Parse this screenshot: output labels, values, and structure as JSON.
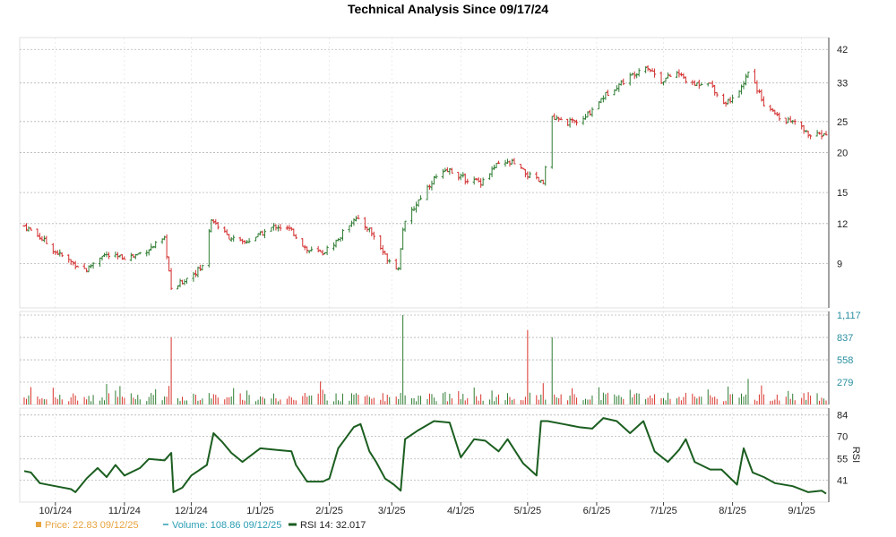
{
  "chart_data": {
    "type": "ohlc",
    "title": "Technical Analysis Since 09/17/24",
    "price_axis": {
      "scale": "log",
      "ticks": [
        9,
        12,
        15,
        20,
        25,
        33,
        42
      ],
      "range": [
        6.8,
        44
      ]
    },
    "volume_axis": {
      "ticks": [
        "279",
        "558",
        "837",
        "1,117"
      ],
      "tick_values": [
        279,
        558,
        837,
        1117
      ],
      "range": [
        0,
        1117
      ]
    },
    "rsi_axis": {
      "label": "RSI",
      "ticks": [
        41,
        55,
        70,
        84
      ],
      "range": [
        30,
        85
      ]
    },
    "date_axis": {
      "start": "2024-09-17",
      "end": "2025-09-12",
      "ticks": [
        "10/1/24",
        "11/1/24",
        "12/1/24",
        "1/1/25",
        "2/1/25",
        "3/1/25",
        "4/1/25",
        "5/1/25",
        "6/1/25",
        "7/1/25",
        "8/1/25",
        "9/1/25"
      ]
    },
    "grid": true,
    "price_series": [
      {
        "date": "2024-09-17",
        "close": 11.8
      },
      {
        "date": "2024-09-24",
        "close": 10.9
      },
      {
        "date": "2024-10-01",
        "close": 9.8
      },
      {
        "date": "2024-10-08",
        "close": 9.1
      },
      {
        "date": "2024-10-15",
        "close": 8.6
      },
      {
        "date": "2024-10-22",
        "close": 9.6
      },
      {
        "date": "2024-10-29",
        "close": 9.4
      },
      {
        "date": "2024-11-05",
        "close": 9.5
      },
      {
        "date": "2024-11-12",
        "close": 10.0
      },
      {
        "date": "2024-11-19",
        "close": 10.7
      },
      {
        "date": "2024-11-22",
        "close": 7.4
      },
      {
        "date": "2024-11-29",
        "close": 8.1
      },
      {
        "date": "2024-12-06",
        "close": 8.8
      },
      {
        "date": "2024-12-10",
        "close": 12.4
      },
      {
        "date": "2024-12-17",
        "close": 11.0
      },
      {
        "date": "2024-12-24",
        "close": 10.4
      },
      {
        "date": "2025-01-01",
        "close": 11.1
      },
      {
        "date": "2025-01-08",
        "close": 11.8
      },
      {
        "date": "2025-01-15",
        "close": 11.4
      },
      {
        "date": "2025-01-22",
        "close": 9.9
      },
      {
        "date": "2025-01-29",
        "close": 9.7
      },
      {
        "date": "2025-02-05",
        "close": 10.7
      },
      {
        "date": "2025-02-12",
        "close": 12.5
      },
      {
        "date": "2025-02-19",
        "close": 11.5
      },
      {
        "date": "2025-02-26",
        "close": 9.5
      },
      {
        "date": "2025-03-04",
        "close": 8.7
      },
      {
        "date": "2025-03-06",
        "close": 11.6
      },
      {
        "date": "2025-03-13",
        "close": 14.2
      },
      {
        "date": "2025-03-20",
        "close": 16.6
      },
      {
        "date": "2025-03-27",
        "close": 17.6
      },
      {
        "date": "2025-04-03",
        "close": 16.5
      },
      {
        "date": "2025-04-10",
        "close": 16.2
      },
      {
        "date": "2025-04-17",
        "close": 18.2
      },
      {
        "date": "2025-04-24",
        "close": 18.6
      },
      {
        "date": "2025-05-01",
        "close": 17.0
      },
      {
        "date": "2025-05-08",
        "close": 16.0
      },
      {
        "date": "2025-05-12",
        "close": 25.5
      },
      {
        "date": "2025-05-19",
        "close": 24.8
      },
      {
        "date": "2025-05-26",
        "close": 25.2
      },
      {
        "date": "2025-06-02",
        "close": 29.0
      },
      {
        "date": "2025-06-09",
        "close": 32.0
      },
      {
        "date": "2025-06-16",
        "close": 34.5
      },
      {
        "date": "2025-06-23",
        "close": 37.5
      },
      {
        "date": "2025-06-30",
        "close": 33.5
      },
      {
        "date": "2025-07-07",
        "close": 35.5
      },
      {
        "date": "2025-07-14",
        "close": 32.5
      },
      {
        "date": "2025-07-21",
        "close": 33.5
      },
      {
        "date": "2025-07-28",
        "close": 28.5
      },
      {
        "date": "2025-08-04",
        "close": 30.5
      },
      {
        "date": "2025-08-08",
        "close": 36.0
      },
      {
        "date": "2025-08-15",
        "close": 28.5
      },
      {
        "date": "2025-08-22",
        "close": 25.5
      },
      {
        "date": "2025-08-29",
        "close": 24.8
      },
      {
        "date": "2025-09-05",
        "close": 22.5
      },
      {
        "date": "2025-09-12",
        "close": 22.83
      }
    ],
    "rsi_series": [
      {
        "date": "2024-09-17",
        "value": 47
      },
      {
        "date": "2024-09-20",
        "value": 46
      },
      {
        "date": "2024-09-24",
        "value": 39
      },
      {
        "date": "2024-10-01",
        "value": 37
      },
      {
        "date": "2024-10-08",
        "value": 35
      },
      {
        "date": "2024-10-10",
        "value": 33
      },
      {
        "date": "2024-10-15",
        "value": 42
      },
      {
        "date": "2024-10-20",
        "value": 49
      },
      {
        "date": "2024-10-24",
        "value": 43
      },
      {
        "date": "2024-10-28",
        "value": 51
      },
      {
        "date": "2024-11-01",
        "value": 44
      },
      {
        "date": "2024-11-08",
        "value": 49
      },
      {
        "date": "2024-11-12",
        "value": 55
      },
      {
        "date": "2024-11-19",
        "value": 54
      },
      {
        "date": "2024-11-22",
        "value": 59
      },
      {
        "date": "2024-11-23",
        "value": 33
      },
      {
        "date": "2024-11-27",
        "value": 36
      },
      {
        "date": "2024-12-01",
        "value": 44
      },
      {
        "date": "2024-12-08",
        "value": 51
      },
      {
        "date": "2024-12-11",
        "value": 72
      },
      {
        "date": "2024-12-15",
        "value": 66
      },
      {
        "date": "2024-12-19",
        "value": 59
      },
      {
        "date": "2024-12-24",
        "value": 53
      },
      {
        "date": "2025-01-01",
        "value": 62
      },
      {
        "date": "2025-01-08",
        "value": 61
      },
      {
        "date": "2025-01-15",
        "value": 60
      },
      {
        "date": "2025-01-17",
        "value": 51
      },
      {
        "date": "2025-01-22",
        "value": 40
      },
      {
        "date": "2025-01-29",
        "value": 40
      },
      {
        "date": "2025-02-01",
        "value": 42
      },
      {
        "date": "2025-02-05",
        "value": 62
      },
      {
        "date": "2025-02-12",
        "value": 76
      },
      {
        "date": "2025-02-15",
        "value": 78
      },
      {
        "date": "2025-02-19",
        "value": 60
      },
      {
        "date": "2025-02-22",
        "value": 53
      },
      {
        "date": "2025-02-26",
        "value": 42
      },
      {
        "date": "2025-03-02",
        "value": 38
      },
      {
        "date": "2025-03-05",
        "value": 34
      },
      {
        "date": "2025-03-07",
        "value": 68
      },
      {
        "date": "2025-03-13",
        "value": 74
      },
      {
        "date": "2025-03-20",
        "value": 80
      },
      {
        "date": "2025-03-27",
        "value": 79
      },
      {
        "date": "2025-04-01",
        "value": 56
      },
      {
        "date": "2025-04-07",
        "value": 68
      },
      {
        "date": "2025-04-12",
        "value": 67
      },
      {
        "date": "2025-04-18",
        "value": 60
      },
      {
        "date": "2025-04-22",
        "value": 68
      },
      {
        "date": "2025-04-29",
        "value": 52
      },
      {
        "date": "2025-05-05",
        "value": 44
      },
      {
        "date": "2025-05-07",
        "value": 80
      },
      {
        "date": "2025-05-10",
        "value": 80
      },
      {
        "date": "2025-05-17",
        "value": 78
      },
      {
        "date": "2025-05-24",
        "value": 76
      },
      {
        "date": "2025-05-30",
        "value": 75
      },
      {
        "date": "2025-06-04",
        "value": 82
      },
      {
        "date": "2025-06-10",
        "value": 80
      },
      {
        "date": "2025-06-16",
        "value": 72
      },
      {
        "date": "2025-06-22",
        "value": 80
      },
      {
        "date": "2025-06-27",
        "value": 60
      },
      {
        "date": "2025-07-03",
        "value": 53
      },
      {
        "date": "2025-07-08",
        "value": 61
      },
      {
        "date": "2025-07-11",
        "value": 68
      },
      {
        "date": "2025-07-15",
        "value": 53
      },
      {
        "date": "2025-07-22",
        "value": 48
      },
      {
        "date": "2025-07-27",
        "value": 48
      },
      {
        "date": "2025-08-03",
        "value": 38
      },
      {
        "date": "2025-08-06",
        "value": 62
      },
      {
        "date": "2025-08-10",
        "value": 46
      },
      {
        "date": "2025-08-15",
        "value": 43
      },
      {
        "date": "2025-08-20",
        "value": 39
      },
      {
        "date": "2025-08-28",
        "value": 37
      },
      {
        "date": "2025-09-04",
        "value": 33
      },
      {
        "date": "2025-09-10",
        "value": 34
      },
      {
        "date": "2025-09-12",
        "value": 32.017
      }
    ],
    "volume_spikes": [
      {
        "date": "2024-11-22",
        "value": 840
      },
      {
        "date": "2025-03-06",
        "value": 1117
      },
      {
        "date": "2025-05-01",
        "value": 930
      },
      {
        "date": "2025-05-12",
        "value": 840
      },
      {
        "date": "2025-08-08",
        "value": 320
      }
    ],
    "legend": {
      "price": {
        "label": "Price: 22.83",
        "date": "09/12/25",
        "color": "#e8a33d"
      },
      "volume": {
        "label": "Volume: 108.86",
        "date": "09/12/25",
        "color": "#2a9db3"
      },
      "rsi": {
        "label": "RSI 14: 32.017",
        "color": "#1b5e20"
      }
    },
    "colors": {
      "up": "#2e7d32",
      "down": "#d32f2f",
      "volume": "#d9342b",
      "volume_up": "#2e7d32",
      "rsi": "#1b5e20",
      "grid": "#b5b5b5"
    }
  }
}
